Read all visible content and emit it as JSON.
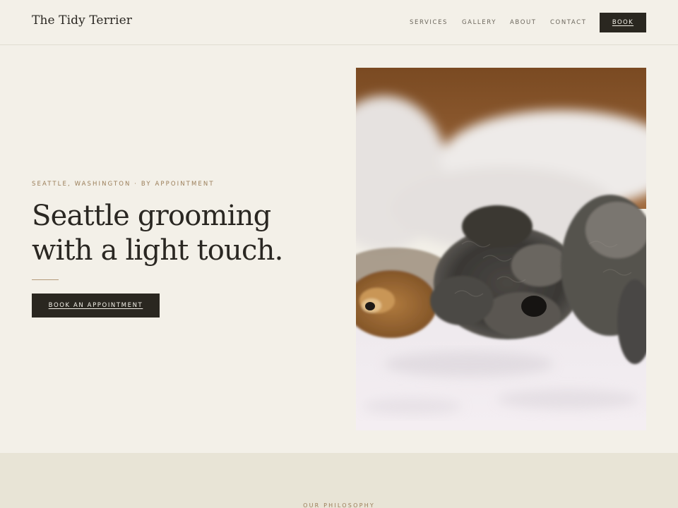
{
  "header": {
    "brand": "The Tidy Terrier",
    "nav": {
      "services": "SERVICES",
      "gallery": "GALLERY",
      "about": "ABOUT",
      "contact": "CONTACT"
    },
    "book_label": "BOOK"
  },
  "hero": {
    "eyebrow": "SEATTLE, WASHINGTON · BY APPOINTMENT",
    "headline_line1": "Seattle grooming",
    "headline_line2": "with a light touch.",
    "cta_label": "BOOK AN APPOINTMENT",
    "photo_alt": "Three small dogs sleeping on a white bed"
  },
  "philosophy": {
    "label": "OUR PHILOSOPHY"
  },
  "colors": {
    "background": "#f3f0e8",
    "band": "#e8e4d6",
    "dark_button": "#2a2720",
    "accent": "#9a7d58"
  }
}
